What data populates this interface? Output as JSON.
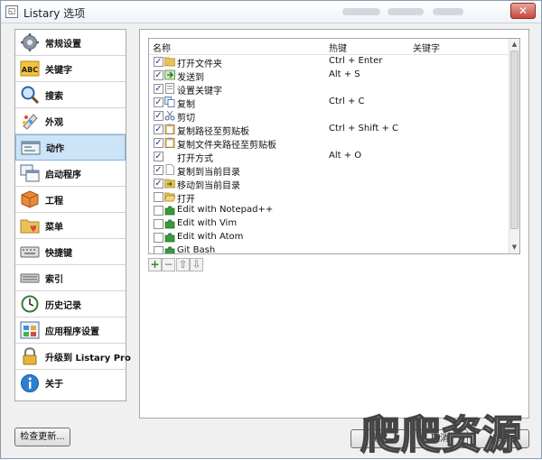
{
  "window": {
    "title": "Listary 选项"
  },
  "sidebar": {
    "items": [
      {
        "label": "常规设置",
        "icon": "gear-icon"
      },
      {
        "label": "关键字",
        "icon": "abc-icon"
      },
      {
        "label": "搜索",
        "icon": "magnifier-icon"
      },
      {
        "label": "外观",
        "icon": "palette-icon"
      },
      {
        "label": "动作",
        "icon": "action-window-icon"
      },
      {
        "label": "启动程序",
        "icon": "launch-windows-icon"
      },
      {
        "label": "工程",
        "icon": "project-cube-icon"
      },
      {
        "label": "菜单",
        "icon": "menu-folder-heart-icon"
      },
      {
        "label": "快捷键",
        "icon": "keyboard-icon"
      },
      {
        "label": "索引",
        "icon": "index-keyboard-icon"
      },
      {
        "label": "历史记录",
        "icon": "clock-icon"
      },
      {
        "label": "应用程序设置",
        "icon": "app-grid-icon"
      },
      {
        "label": "升级到 Listary Pro",
        "icon": "lock-icon"
      },
      {
        "label": "关于",
        "icon": "info-icon"
      }
    ],
    "selected": "动作"
  },
  "actions": {
    "columns": {
      "name": "名称",
      "hotkey": "热键",
      "keyword": "关键字"
    },
    "rows": [
      {
        "checked": true,
        "icon": "folder-icon",
        "label": "打开文件夹",
        "hotkey": "Ctrl + Enter"
      },
      {
        "checked": true,
        "icon": "send-arrow-icon",
        "label": "发送到",
        "hotkey": "Alt + S"
      },
      {
        "checked": true,
        "icon": "keyword-page-icon",
        "label": "设置关键字",
        "hotkey": ""
      },
      {
        "checked": true,
        "icon": "copy-icon",
        "label": "复制",
        "hotkey": "Ctrl + C"
      },
      {
        "checked": true,
        "icon": "scissors-icon",
        "label": "剪切",
        "hotkey": ""
      },
      {
        "checked": true,
        "icon": "clipboard-icon",
        "label": "复制路径至剪贴板",
        "hotkey": "Ctrl + Shift + C"
      },
      {
        "checked": true,
        "icon": "clipboard-icon",
        "label": "复制文件夹路径至剪贴板",
        "hotkey": ""
      },
      {
        "checked": true,
        "icon": "",
        "label": "打开方式",
        "hotkey": "Alt + O"
      },
      {
        "checked": true,
        "icon": "page-icon",
        "label": "复制到当前目录",
        "hotkey": ""
      },
      {
        "checked": true,
        "icon": "move-folder-icon",
        "label": "移动到当前目录",
        "hotkey": ""
      },
      {
        "checked": false,
        "icon": "open-folder-icon",
        "label": "打开",
        "hotkey": ""
      },
      {
        "checked": false,
        "icon": "puzzle-icon",
        "label": "Edit with Notepad++",
        "hotkey": ""
      },
      {
        "checked": false,
        "icon": "puzzle-icon",
        "label": "Edit with Vim",
        "hotkey": ""
      },
      {
        "checked": false,
        "icon": "puzzle-icon",
        "label": "Edit with Atom",
        "hotkey": ""
      },
      {
        "checked": false,
        "icon": "puzzle-icon",
        "label": "Git Bash",
        "hotkey": ""
      }
    ]
  },
  "toolbar": {
    "add": "+",
    "remove": "−",
    "up": "⇧",
    "down": "⇩"
  },
  "buttons": {
    "check_updates": "检查更新...",
    "ok": "确定",
    "cancel": "取消",
    "apply": "应用"
  },
  "watermark": {
    "text": "爬爬资源"
  },
  "colors": {
    "selected_bg": "#cde4f7",
    "selected_border": "#7fb3e0",
    "puzzle_green": "#3a9a3a",
    "folder_yellow": "#e8c25a"
  }
}
